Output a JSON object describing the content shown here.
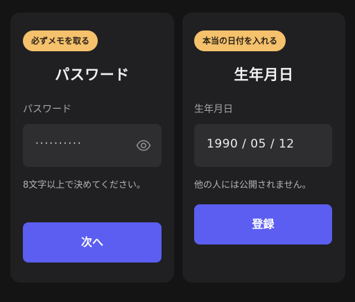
{
  "password_card": {
    "badge": "必ずメモを取る",
    "title": "パスワード",
    "field_label": "パスワード",
    "masked_value": "··········",
    "toggle_icon": "eye-icon",
    "hint": "8文字以上で決めてください。",
    "next_label": "次へ"
  },
  "birthdate_card": {
    "badge": "本当の日付を入れる",
    "title": "生年月日",
    "field_label": "生年月日",
    "date_value": "1990 / 05 / 12",
    "hint": "他の人には公開されません。",
    "submit_label": "登録"
  },
  "colors": {
    "background": "#141414",
    "card": "#202022",
    "input": "#2e2e31",
    "badge": "#f5c16c",
    "primary": "#5b5ef0"
  }
}
